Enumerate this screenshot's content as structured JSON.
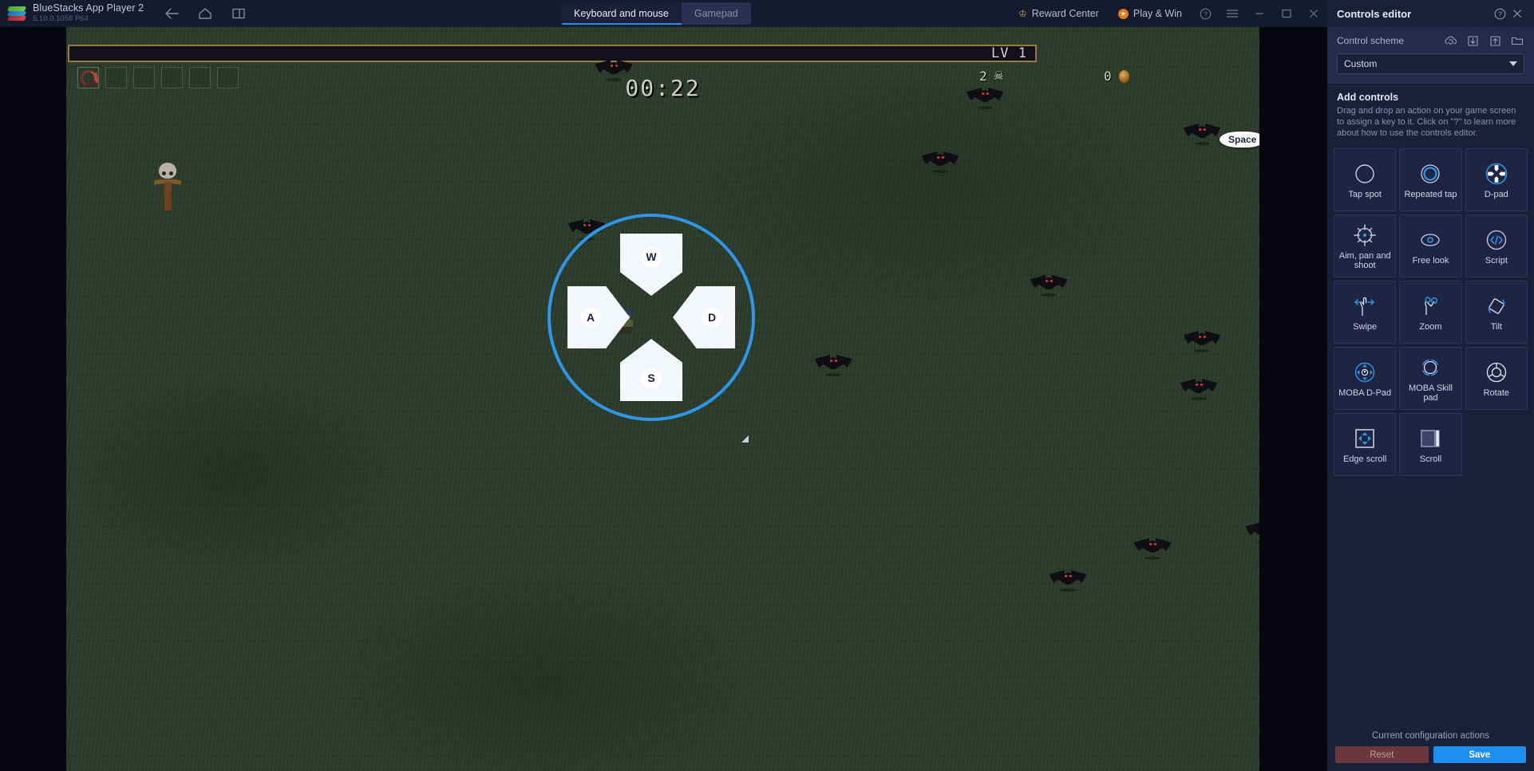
{
  "titlebar": {
    "app_name": "BlueStacks App Player 2",
    "version": "5.10.0.1058  P64",
    "nav": [
      {
        "name": "back-icon",
        "label": "Back"
      },
      {
        "name": "home-icon",
        "label": "Home"
      },
      {
        "name": "multi-instance-icon",
        "label": "Multi-instance"
      }
    ],
    "tabs": [
      {
        "label": "Keyboard and mouse",
        "active": true
      },
      {
        "label": "Gamepad",
        "active": false
      }
    ],
    "reward_center": "Reward Center",
    "play_win": "Play & Win",
    "window_buttons": [
      "help-icon",
      "menu-icon",
      "minimize-icon",
      "maximize-icon",
      "close-icon"
    ]
  },
  "game": {
    "level_text": "LV 1",
    "timer": "00:22",
    "kill_count": "2",
    "coin_count": "0",
    "item_slots": 6,
    "dpad": {
      "up_key": "W",
      "left_key": "A",
      "down_key": "S",
      "right_key": "D"
    },
    "space_key": "Space"
  },
  "panel": {
    "title": "Controls editor",
    "scheme_label": "Control scheme",
    "scheme_icons": [
      "cloud-sync-icon",
      "import-icon",
      "export-icon",
      "folder-icon"
    ],
    "scheme_value": "Custom",
    "add_controls_title": "Add controls",
    "add_controls_desc": "Drag and drop an action on your game screen to assign a key to it. Click on \"?\" to learn more about how to use the controls editor.",
    "tiles": [
      {
        "label": "Tap spot",
        "icon": "tap-spot-icon",
        "highlight": false
      },
      {
        "label": "Repeated tap",
        "icon": "repeated-tap-icon",
        "highlight": false
      },
      {
        "label": "D-pad",
        "icon": "d-pad-icon",
        "highlight": true
      },
      {
        "label": "Aim, pan and shoot",
        "icon": "aim-pan-shoot-icon",
        "highlight": false
      },
      {
        "label": "Free look",
        "icon": "free-look-icon",
        "highlight": false
      },
      {
        "label": "Script",
        "icon": "script-icon",
        "highlight": false
      },
      {
        "label": "Swipe",
        "icon": "swipe-icon",
        "highlight": false
      },
      {
        "label": "Zoom",
        "icon": "zoom-icon",
        "highlight": false
      },
      {
        "label": "Tilt",
        "icon": "tilt-icon",
        "highlight": false
      },
      {
        "label": "MOBA D-Pad",
        "icon": "moba-d-pad-icon",
        "highlight": false
      },
      {
        "label": "MOBA Skill pad",
        "icon": "moba-skill-pad-icon",
        "highlight": false
      },
      {
        "label": "Rotate",
        "icon": "rotate-icon",
        "highlight": false
      },
      {
        "label": "Edge scroll",
        "icon": "edge-scroll-icon",
        "highlight": false
      },
      {
        "label": "Scroll",
        "icon": "scroll-icon",
        "highlight": false
      }
    ],
    "footer_label": "Current configuration actions",
    "reset_label": "Reset",
    "save_label": "Save"
  },
  "colors": {
    "panel_bg": "#1b2039",
    "accent_blue": "#1e8ef0",
    "reset_red": "#6d3740",
    "titlebar_bg": "#161a2e"
  }
}
